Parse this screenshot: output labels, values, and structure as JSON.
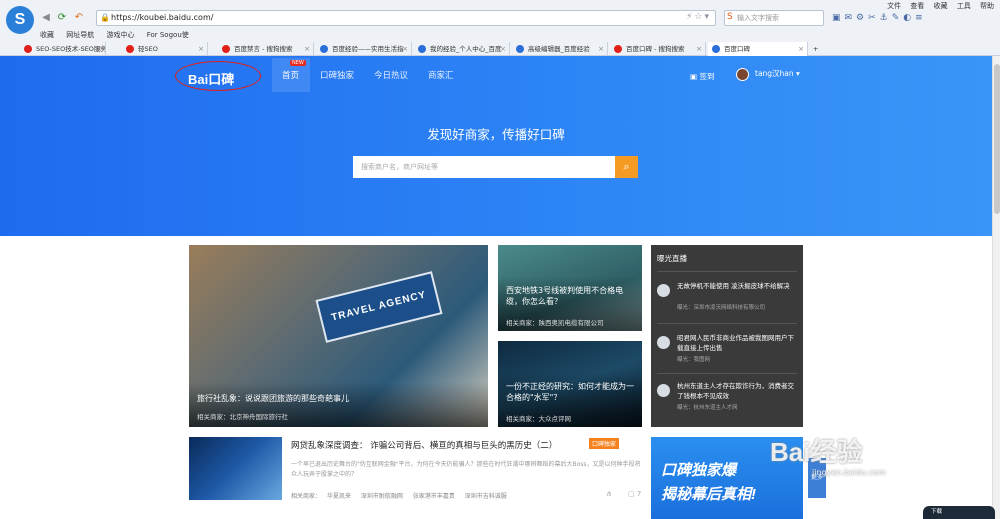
{
  "browser": {
    "url": "https://koubei.baidu.com/",
    "search_placeholder": "输入文字搜索",
    "menu": [
      "文件",
      "查看",
      "收藏",
      "工具",
      "帮助"
    ],
    "bookmarks": [
      "收藏",
      "网址导航",
      "游戏中心",
      "For Sogou使"
    ],
    "tabs": [
      {
        "label": "SEO-SEO技术-SEO服务",
        "color": "#e0201b"
      },
      {
        "label": "轻SEO",
        "color": "#e0201b"
      },
      {
        "label": "百度禁言 - 搜狗搜索",
        "color": "#e0201b"
      },
      {
        "label": "百度经验——实用生活指",
        "color": "#2a6fd8"
      },
      {
        "label": "我的经验_个人中心_百度",
        "color": "#2a6fd8"
      },
      {
        "label": "高级编辑器_百度经验",
        "color": "#2a6fd8"
      },
      {
        "label": "百度口碑 - 搜狗搜索",
        "color": "#e0201b"
      },
      {
        "label": "百度口碑",
        "color": "#2a6fd8",
        "active": true
      }
    ]
  },
  "header": {
    "brand": "Bai口碑",
    "nav": [
      {
        "label": "首页",
        "active": true
      },
      {
        "label": "口碑独家"
      },
      {
        "label": "今日热议"
      },
      {
        "label": "商家汇"
      }
    ],
    "new_badge": "NEW",
    "signin": "签到",
    "username": "tang汉han"
  },
  "hero": {
    "slogan": "发现好商家，传播好口碑",
    "search_placeholder": "搜索商户名，商户网址等"
  },
  "cards": {
    "big": {
      "storefront": "TRAVEL AGENCY",
      "title": "旅行社乱象：说说跟团旅游的那些奇葩事儿",
      "meta": "相关商家：北京神舟国际旅行社"
    },
    "mid1": {
      "title": "西安地铁3号线被判使用不合格电缆，你怎么看？",
      "meta": "相关商家：陕西奥凯电缆有限公司"
    },
    "mid2": {
      "title": "一份不正经的研究：如何才能成为一合格的\"水军\"？",
      "meta": "相关商家：大众点评网"
    }
  },
  "live": {
    "heading": "曝光直播",
    "items": [
      {
        "text": "无故停机不能使用 凌沃掘皮球不给解决",
        "meta": "曝光：深圳市凌沃网络科技有限公司"
      },
      {
        "text": "昭君网人民币非商业作品被我图网用户下载直接上传出售",
        "meta": "曝光：我图网"
      },
      {
        "text": "杭州东道主人才存在欺诈行为，消费者交了钱根本不见成效",
        "meta": "曝光：杭州东道主人才网"
      }
    ]
  },
  "article": {
    "title": "网贷乱象深度调查： 诈骗公司背后、横亘的真相与巨头的黑历史（二）",
    "tag": "口碑独家",
    "summary": "一个早已退出历史舞台的\"伪互联网金融\"平台，为何在今天仍能骗人？那些在时代狂潮中哪辨舞蹈的幕后大Boss，又是以何种手段将众人玩弄于股掌之中的？",
    "related_label": "相关商家：",
    "related": [
      "华夏凯来",
      "深圳市耐航融网",
      "张家港市丰嘉贵",
      "深圳市吉科诚服"
    ],
    "comments": "7"
  },
  "banner": {
    "line1": "口碑独家爆",
    "line2": "揭秘幕后真相!",
    "side_btn": "更多"
  },
  "watermark": {
    "brand": "Bai经验",
    "sub": "jingyan.baidu.com"
  },
  "corner": "下载"
}
